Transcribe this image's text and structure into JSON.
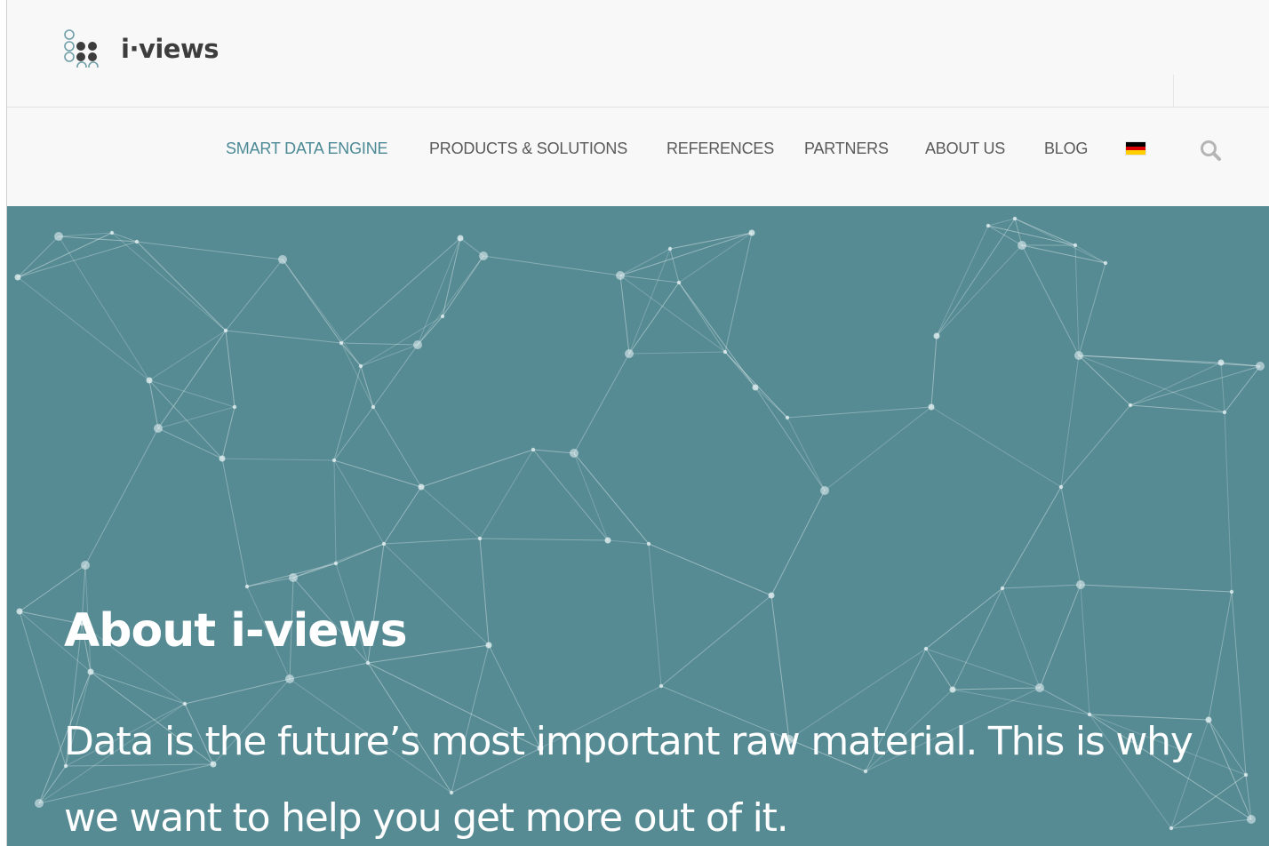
{
  "header": {
    "logo_text": "i·views",
    "logo_icon": "i-views-dot-grid-logo"
  },
  "nav": {
    "items": [
      {
        "label": "SMART DATA ENGINE",
        "active": true
      },
      {
        "label": "PRODUCTS & SOLUTIONS",
        "active": false
      },
      {
        "label": "REFERENCES",
        "active": false
      },
      {
        "label": "PARTNERS",
        "active": false
      },
      {
        "label": "ABOUT US",
        "active": false
      },
      {
        "label": "BLOG",
        "active": false
      }
    ],
    "language_flag": "german-flag-icon",
    "search_icon": "search-icon"
  },
  "hero": {
    "title": "About i-views",
    "subtitle": "Data is the future’s most important raw material. This is why we want to help you get more out of it.",
    "background": "network-graph"
  },
  "colors": {
    "accent": "#4b8a95",
    "hero_background": "#568b94",
    "nav_text": "#5a5a5a",
    "logo_text": "#3d3d3d",
    "flag": [
      "#000000",
      "#dd0000",
      "#ffce00"
    ]
  }
}
